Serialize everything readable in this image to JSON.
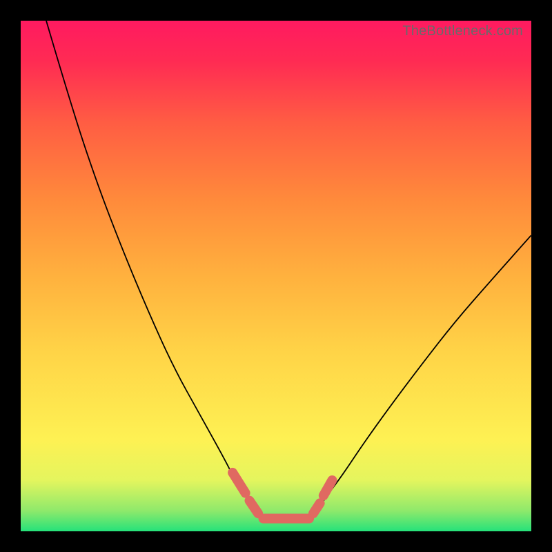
{
  "watermark": "TheBottleneck.com",
  "chart_data": {
    "type": "line",
    "title": "",
    "xlabel": "",
    "ylabel": "",
    "xlim": [
      0,
      100
    ],
    "ylim": [
      0,
      100
    ],
    "gradient_stops": [
      {
        "pos": 0,
        "color": "#25e27a"
      },
      {
        "pos": 4,
        "color": "#8ee96b"
      },
      {
        "pos": 10,
        "color": "#e4f55e"
      },
      {
        "pos": 18,
        "color": "#fef153"
      },
      {
        "pos": 35,
        "color": "#ffd447"
      },
      {
        "pos": 50,
        "color": "#ffb13e"
      },
      {
        "pos": 65,
        "color": "#ff8a3b"
      },
      {
        "pos": 80,
        "color": "#ff5d43"
      },
      {
        "pos": 92,
        "color": "#ff2b53"
      },
      {
        "pos": 100,
        "color": "#ff1a60"
      }
    ],
    "series": [
      {
        "name": "left-branch",
        "x": [
          5,
          10,
          15,
          20,
          25,
          30,
          35,
          40,
          42,
          44,
          46
        ],
        "y": [
          100,
          83,
          68,
          55,
          43,
          32,
          23,
          14,
          10,
          7,
          4
        ]
      },
      {
        "name": "right-branch",
        "x": [
          58,
          60,
          63,
          67,
          72,
          78,
          85,
          92,
          100
        ],
        "y": [
          4,
          7,
          11,
          17,
          24,
          32,
          41,
          49,
          58
        ]
      }
    ],
    "flat_bottom_region": {
      "x_start": 46,
      "x_end": 58,
      "y": 2.5
    },
    "highlight_segments": [
      {
        "x1": 41.5,
        "y1": 11.5,
        "x2": 44.0,
        "y2": 7.5
      },
      {
        "x1": 44.8,
        "y1": 6.0,
        "x2": 46.5,
        "y2": 3.5
      },
      {
        "x1": 47.5,
        "y1": 2.5,
        "x2": 56.5,
        "y2": 2.5
      },
      {
        "x1": 57.3,
        "y1": 3.5,
        "x2": 58.6,
        "y2": 5.5
      },
      {
        "x1": 59.3,
        "y1": 7.0,
        "x2": 61.0,
        "y2": 10.0
      }
    ],
    "highlight_color": "#e06961",
    "curve_color": "#000000"
  }
}
